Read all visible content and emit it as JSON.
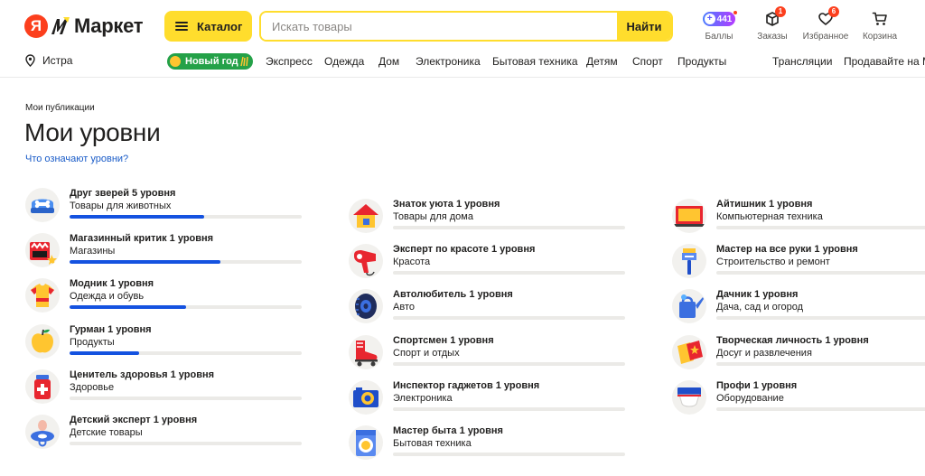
{
  "header": {
    "logo_ya": "Я",
    "logo_text": "Маркет",
    "catalog_label": "Каталог",
    "search_placeholder": "Искать товары",
    "search_button": "Найти",
    "actions": {
      "points": {
        "label": "Баллы",
        "value": "441"
      },
      "orders": {
        "label": "Заказы",
        "badge": "1"
      },
      "favorites": {
        "label": "Избранное",
        "badge": "6"
      },
      "cart": {
        "label": "Корзина"
      }
    }
  },
  "nav": {
    "location": "Истра",
    "new_year": "Новый год",
    "items": [
      "Экспресс",
      "Одежда",
      "Дом",
      "Электроника",
      "Бытовая техника",
      "Детям",
      "Спорт",
      "Продукты"
    ],
    "broadcasts": "Трансляции",
    "sell": "Продавайте на Ма"
  },
  "page": {
    "breadcrumb": "Мои публикации",
    "title": "Мои уровни",
    "help_link": "Что означают уровни?"
  },
  "colors": {
    "accent_yellow": "#ffdd2d",
    "brand_red": "#fc3f1d",
    "progress_blue": "#1452e0",
    "link_blue": "#1a5cc8",
    "new_year_green": "#24a148"
  },
  "levels": {
    "col1": [
      {
        "title": "Друг зверей 5 уровня",
        "category": "Товары для животных",
        "progress": 0.58,
        "icon": "pet-bowl-icon"
      },
      {
        "title": "Магазинный критик 1 уровня",
        "category": "Магазины",
        "progress": 0.65,
        "icon": "shop-icon"
      },
      {
        "title": "Модник 1 уровня",
        "category": "Одежда и обувь",
        "progress": 0.5,
        "icon": "tshirt-icon"
      },
      {
        "title": "Гурман 1 уровня",
        "category": "Продукты",
        "progress": 0.3,
        "icon": "apple-icon"
      },
      {
        "title": "Ценитель здоровья 1 уровня",
        "category": "Здоровье",
        "progress": 0,
        "icon": "medicine-icon"
      },
      {
        "title": "Детский эксперт 1 уровня",
        "category": "Детские товары",
        "progress": 0,
        "icon": "pacifier-icon"
      }
    ],
    "col2": [
      {
        "title": "Знаток уюта 1 уровня",
        "category": "Товары для дома",
        "progress": 0,
        "icon": "house-icon"
      },
      {
        "title": "Эксперт по красоте 1 уровня",
        "category": "Красота",
        "progress": 0,
        "icon": "hairdryer-icon"
      },
      {
        "title": "Автолюбитель 1 уровня",
        "category": "Авто",
        "progress": 0,
        "icon": "tire-icon"
      },
      {
        "title": "Спортсмен 1 уровня",
        "category": "Спорт и отдых",
        "progress": 0,
        "icon": "roller-skate-icon"
      },
      {
        "title": "Инспектор гаджетов 1 уровня",
        "category": "Электроника",
        "progress": 0,
        "icon": "camera-icon"
      },
      {
        "title": "Мастер быта 1 уровня",
        "category": "Бытовая техника",
        "progress": 0,
        "icon": "washing-machine-icon"
      }
    ],
    "col3": [
      {
        "title": "Айтишник 1 уровня",
        "category": "Компьютерная техника",
        "progress": 0,
        "icon": "laptop-icon"
      },
      {
        "title": "Мастер на все руки 1 уровня",
        "category": "Строительство и ремонт",
        "progress": 0,
        "icon": "paint-brush-icon"
      },
      {
        "title": "Дачник 1 уровня",
        "category": "Дача, сад и огород",
        "progress": 0,
        "icon": "watering-can-icon"
      },
      {
        "title": "Творческая личность 1 уровня",
        "category": "Досуг и развлечения",
        "progress": 0,
        "icon": "tickets-icon"
      },
      {
        "title": "Профи 1 уровня",
        "category": "Оборудование",
        "progress": 0,
        "icon": "equipment-icon"
      }
    ]
  }
}
